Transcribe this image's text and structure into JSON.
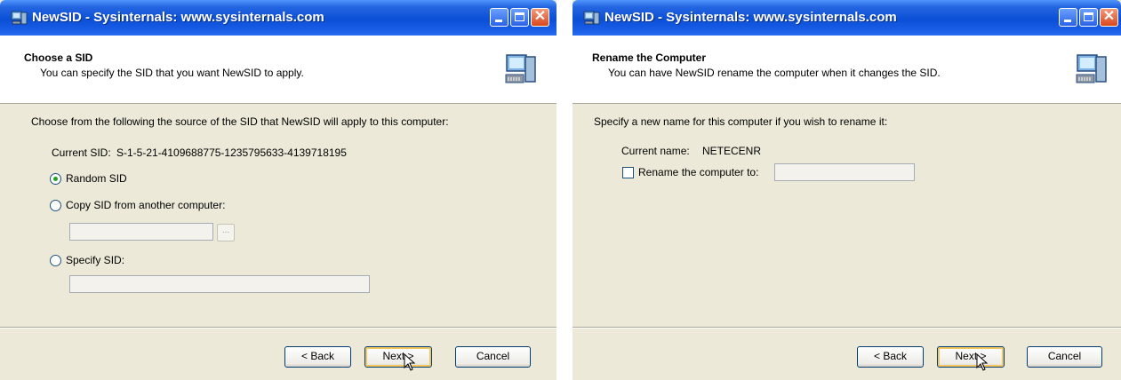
{
  "left_dialog": {
    "title": "NewSID - Sysinternals: www.sysinternals.com",
    "header_title": "Choose a SID",
    "header_subtitle": "You can specify the SID that you want NewSID to apply.",
    "instruction": "Choose from the following the source of the SID that NewSID will apply to this computer:",
    "current_sid_label": "Current SID:",
    "current_sid_value": "S-1-5-21-4109688775-1235795633-4139718195",
    "options": [
      {
        "label": "Random SID",
        "selected": true
      },
      {
        "label": "Copy SID from another computer:",
        "selected": false
      },
      {
        "label": "Specify SID:",
        "selected": false
      }
    ],
    "copy_sid_value": "",
    "browse_label": "...",
    "specify_sid_value": "",
    "buttons": {
      "back": "< Back",
      "next": "Next >",
      "cancel": "Cancel"
    }
  },
  "right_dialog": {
    "title": "NewSID - Sysinternals: www.sysinternals.com",
    "header_title": "Rename the Computer",
    "header_subtitle": "You can have NewSID rename the computer when it changes the SID.",
    "instruction": "Specify a new name for this computer if you wish to rename it:",
    "current_name_label": "Current name:",
    "current_name_value": "NETECENR",
    "rename_checkbox_label": "Rename the computer to:",
    "rename_checked": false,
    "new_name_value": "",
    "buttons": {
      "back": "< Back",
      "next": "Next >",
      "cancel": "Cancel"
    }
  },
  "icons": {
    "app": "computer-app-icon",
    "header": "computer-wizard-icon",
    "cursor": "mouse-pointer-icon"
  },
  "colors": {
    "titlebar": "#0a4fd6",
    "dialog_bg": "#ece9d8",
    "close_button": "#d8481f",
    "radio_dot": "#21a121"
  }
}
